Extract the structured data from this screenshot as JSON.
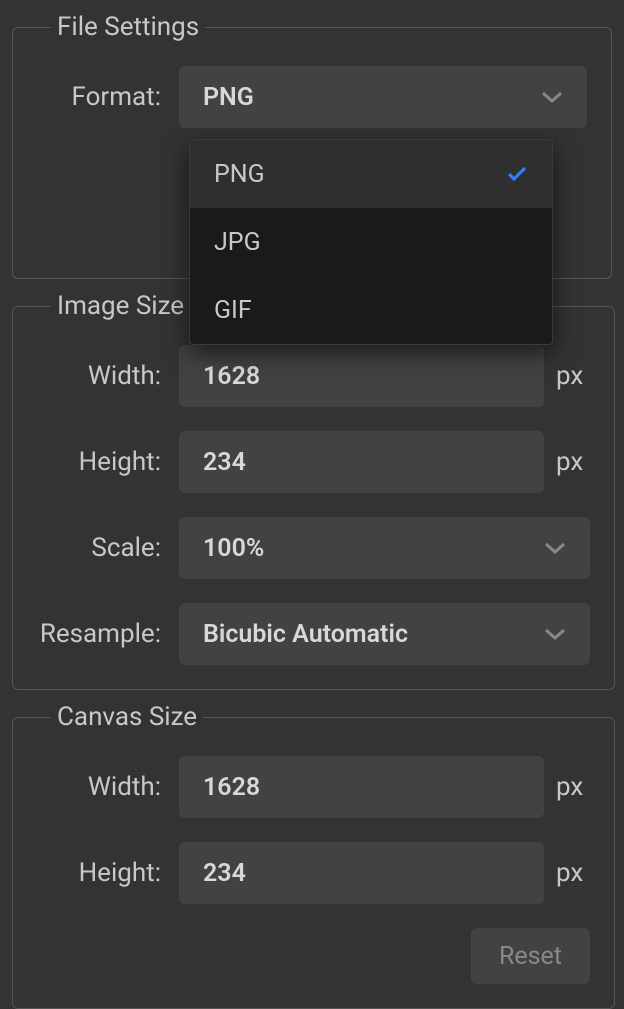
{
  "file_settings": {
    "legend": "File Settings",
    "format_label": "Format:",
    "format_value": "PNG",
    "format_options": [
      {
        "label": "PNG",
        "selected": true
      },
      {
        "label": "JPG",
        "selected": false
      },
      {
        "label": "GIF",
        "selected": false
      }
    ]
  },
  "image_size": {
    "legend": "Image Size",
    "width_label": "Width:",
    "width_value": "1628",
    "width_unit": "px",
    "height_label": "Height:",
    "height_value": "234",
    "height_unit": "px",
    "scale_label": "Scale:",
    "scale_value": "100%",
    "resample_label": "Resample:",
    "resample_value": "Bicubic Automatic"
  },
  "canvas_size": {
    "legend": "Canvas Size",
    "width_label": "Width:",
    "width_value": "1628",
    "width_unit": "px",
    "height_label": "Height:",
    "height_value": "234",
    "height_unit": "px",
    "reset_label": "Reset"
  }
}
